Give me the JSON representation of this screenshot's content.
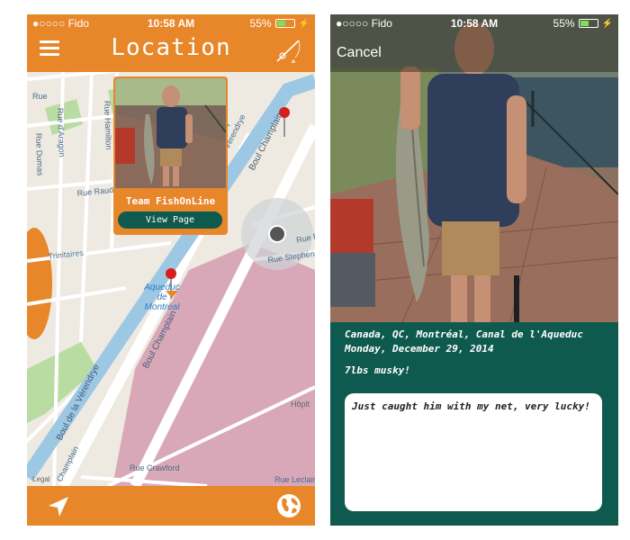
{
  "status_left": {
    "carrier": "●○○○○ Fido",
    "time": "10:58 AM",
    "battery": "55%",
    "battery_level": 0.55
  },
  "status_right": {
    "carrier": "●○○○○ Fido",
    "time": "10:58 AM",
    "battery": "55%",
    "battery_level": 0.55
  },
  "location_screen": {
    "title": "Location",
    "map_labels": {
      "rue_aragon": "Rue d'Aragon",
      "rue_hamilton": "Rue Hamilton",
      "rue_dumas": "Rue Dumas",
      "rue_raudot": "Rue Raudot",
      "rue_trinitaires": "Trinitaires",
      "rue_prefix": "Rue",
      "boul_champlain": "Boul Champlain",
      "boul_champlain_2": "Boul Champlain",
      "boul_champlain_3": "Champlain",
      "boul_verendrye": "Boul de la Vérendrye",
      "verendrye_short": "Vérendrye",
      "rue_rolland": "Rue Rolland",
      "rue_stephens": "Rue Stephens",
      "aqueduc_1": "Aqueduc",
      "aqueduc_2": "de",
      "aqueduc_3": "Montréal",
      "rue_crawford": "Rue Crawford",
      "rue_leclair": "Rue Leclair",
      "hopital": "Hôpit",
      "legal": "Legal"
    },
    "callout": {
      "team": "Team FishOnLine",
      "button": "View Page"
    }
  },
  "catch_screen": {
    "cancel": "Cancel",
    "place": "Canada, QC, Montréal, Canal de l'Aqueduc",
    "date": "Monday, December 29, 2014",
    "catch": "7lbs musky!",
    "comment": "Just caught him with my net, very lucky!"
  },
  "colors": {
    "accent_orange": "#e8862a",
    "teal": "#0f5a4e",
    "canal": "#9cc8e4",
    "park": "#d8a8b8"
  }
}
